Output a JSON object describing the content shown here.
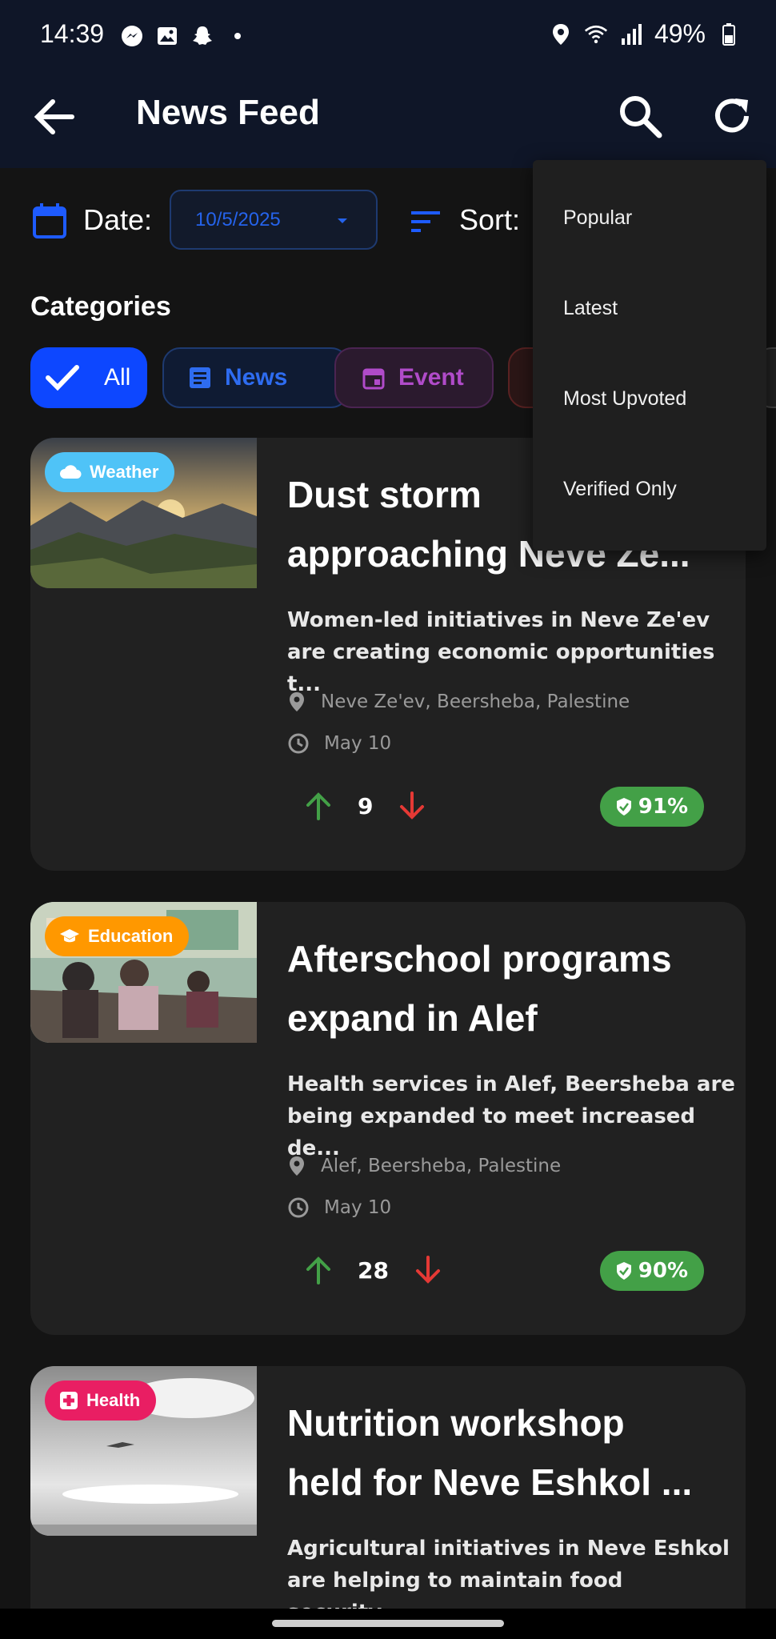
{
  "status_bar": {
    "time": "14:39",
    "battery": "49%",
    "left_icons": [
      "messenger-icon",
      "gallery-icon",
      "snapchat-icon",
      "dot-icon"
    ],
    "right_icons": [
      "location-icon",
      "wifi-icon",
      "signal-icon",
      "battery-icon"
    ]
  },
  "app_bar": {
    "title": "News Feed",
    "back_icon": "arrow-back-icon",
    "search_icon": "search-icon",
    "refresh_icon": "refresh-icon",
    "background": "#0f1628"
  },
  "filters": {
    "date_label": "Date:",
    "date_value": "10/5/2025",
    "sort_label": "Sort:"
  },
  "categories": {
    "title": "Categories",
    "chips": [
      {
        "label": "All",
        "icon": "check-icon",
        "selected": true
      },
      {
        "label": "News",
        "icon": "article-icon",
        "selected": false
      },
      {
        "label": "Event",
        "icon": "calendar-icon",
        "selected": false
      }
    ]
  },
  "sort_menu": {
    "options": [
      "Popular",
      "Latest",
      "Most Upvoted",
      "Verified Only"
    ]
  },
  "posts": [
    {
      "badge": "Weather",
      "badge_color": "#4fc3f7",
      "title_line1": "Dust storm",
      "title_line2": "approaching Neve Ze...",
      "desc_line1": "Women-led initiatives in Neve Ze'ev",
      "desc_line2": "are creating economic opportunities t...",
      "location": "Neve Ze'ev, Beersheba, Palestine",
      "date": "May 10",
      "votes": "9",
      "trust": "91%"
    },
    {
      "badge": "Education",
      "badge_color": "#ff9800",
      "title_line1": "Afterschool programs",
      "title_line2": "expand in Alef",
      "desc_line1": "Health services in Alef, Beersheba are",
      "desc_line2": "being expanded to meet increased de...",
      "location": "Alef, Beersheba, Palestine",
      "date": "May 10",
      "votes": "28",
      "trust": "90%"
    },
    {
      "badge": "Health",
      "badge_color": "#e91e63",
      "title_line1": "Nutrition workshop",
      "title_line2": "held for Neve Eshkol ...",
      "desc_line1": "Agricultural initiatives in Neve Eshkol",
      "desc_line2": "are helping to maintain food security...."
    }
  ],
  "colors": {
    "accent_blue": "#0d47ff",
    "upvote": "#43a047",
    "downvote": "#e53935",
    "trust_badge": "#43a047"
  }
}
